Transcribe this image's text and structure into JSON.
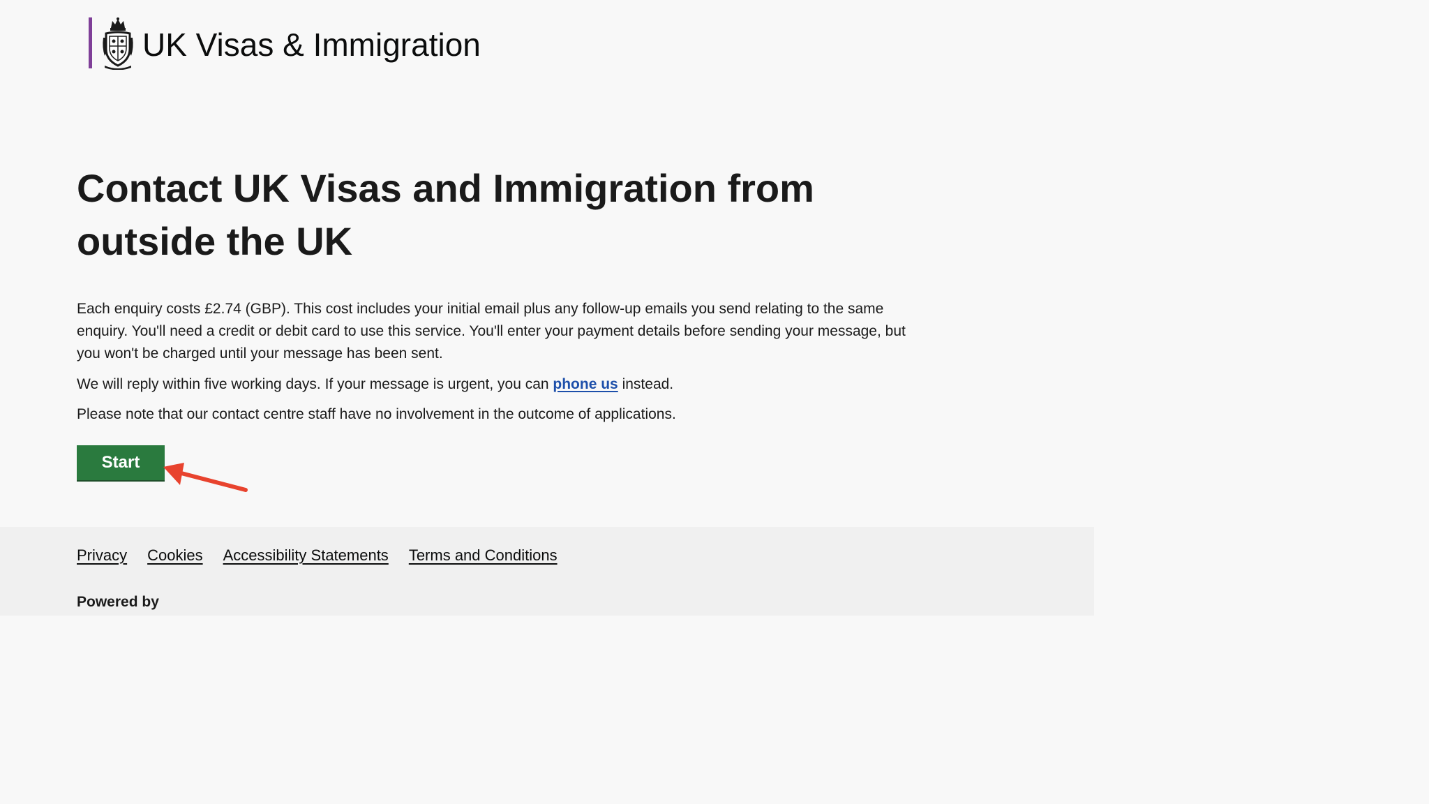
{
  "header": {
    "brand_name": "UK Visas & Immigration",
    "crest_icon": "royal-coat-of-arms-icon",
    "accent_color": "#7f3f98"
  },
  "main": {
    "title": "Contact UK Visas and Immigration from outside the UK",
    "paragraph_1": "Each enquiry costs £2.74 (GBP). This cost includes your initial email plus any follow-up emails you send relating to the same enquiry. You'll need a credit or debit card to use this service. You'll enter your payment details before sending your message, but you won't be charged until your message has been sent.",
    "paragraph_2": {
      "before_link": "We will reply within five working days. If your message is urgent, you can ",
      "link_text": "phone us",
      "after_link": " instead."
    },
    "paragraph_3": "Please note that our contact centre staff have no involvement in the outcome of applications.",
    "start_button": {
      "label": "Start",
      "color": "#2a7a3e"
    }
  },
  "annotation": {
    "arrow_color": "#e8432e"
  },
  "footer": {
    "links": [
      "Privacy",
      "Cookies",
      "Accessibility Statements",
      "Terms and Conditions"
    ],
    "powered_by": "Powered by"
  }
}
